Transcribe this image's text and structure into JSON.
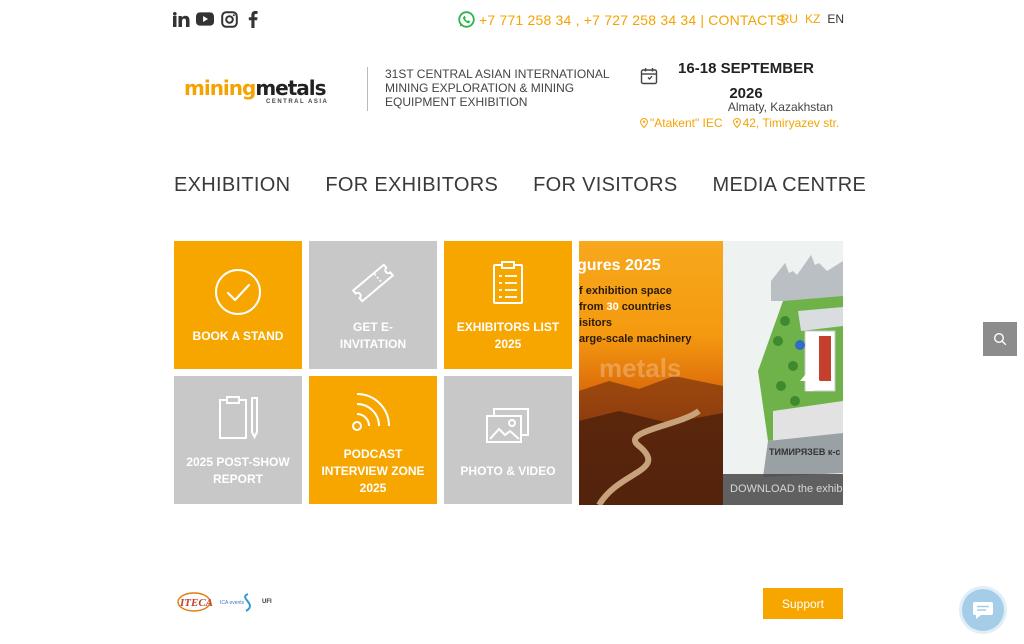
{
  "topbar": {
    "social_icons": [
      "linkedin-icon",
      "youtube-icon",
      "instagram-icon",
      "facebook-icon"
    ],
    "phones": "+7 771 258 34 , +7 727 258 34 34",
    "separator": "|",
    "contacts_label": "CONTACTS",
    "languages": [
      "RU",
      "KZ",
      "EN"
    ],
    "active_language": "EN"
  },
  "header": {
    "logo_part1": "mining",
    "logo_part2": "metals",
    "logo_sub": "CENTRAL ASIA",
    "tagline": "31ST CENTRAL ASIAN INTERNATIONAL MINING EXPLORATION & MINING EQUIPMENT EXHIBITION",
    "date_line1": "16-18 SEPTEMBER",
    "date_line2": "2026",
    "city": "Almaty, Kazakhstan",
    "venue": "\"Atakent\" IEC",
    "address": "42, Timiryazev str."
  },
  "nav": [
    "EXHIBITION",
    "FOR EXHIBITORS",
    "FOR VISITORS",
    "MEDIA CENTRE"
  ],
  "tiles": {
    "book_stand": "BOOK A STAND",
    "e_invitation": "GET E-INVITATION",
    "exhibitors_list": "EXHIBITORS LIST 2025",
    "post_show": "2025 POST-SHOW REPORT",
    "podcast": "PODCAST INTERVIEW ZONE 2025",
    "photo_video": "PHOTO & VIDEO"
  },
  "banner_figures": {
    "heading": "gures 2025",
    "line1": "f exhibition space",
    "line2_a": " from ",
    "line2_num": "30",
    "line2_b": " countries",
    "line3": "isitors",
    "line4": "arge-scale machinery",
    "watermark": "metals"
  },
  "banner_map": {
    "street": "ТИМИРЯЗЕВ к-с",
    "download": "DOWNLOAD the exhib"
  },
  "footer": {
    "support_label": "Support",
    "partner_logos": [
      "ITECA",
      "ICA events",
      "UFI"
    ]
  },
  "colors": {
    "accent": "#f7a600",
    "tile_gray": "#c8c8c8",
    "text": "#3a3a3a"
  }
}
